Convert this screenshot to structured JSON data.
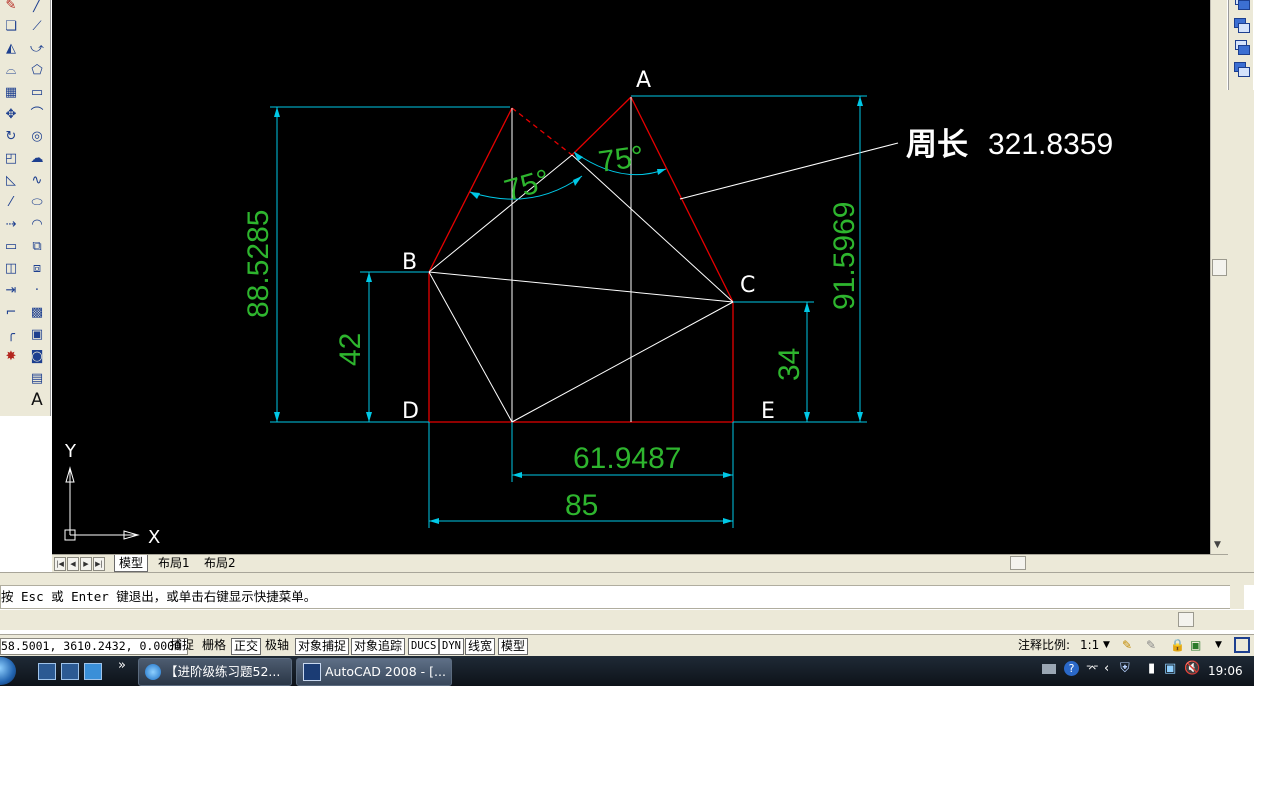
{
  "canvas": {
    "points": {
      "A": "A",
      "B": "B",
      "C": "C",
      "D": "D",
      "E": "E"
    },
    "dimensions": {
      "left_height": "88.5285",
      "right_height": "91.5969",
      "b_height": "42",
      "c_height": "34",
      "inner_width": "61.9487",
      "total_width": "85",
      "angle_left": "75°",
      "angle_right": "75°"
    },
    "annotation": {
      "label": "周长",
      "value": "321.8359"
    },
    "ucs": {
      "x": "X",
      "y": "Y"
    },
    "colors": {
      "background": "#000000",
      "dimension": "#00c8e6",
      "text": "#2eb52e",
      "red_line": "#e60000",
      "white_line": "#ffffff"
    }
  },
  "tabs": [
    "模型",
    "布局1",
    "布局2"
  ],
  "command": {
    "text": "按 Esc 或 Enter 键退出，或单击右键显示快捷菜单。"
  },
  "status": {
    "coords": "58.5001, 3610.2432, 0.0000",
    "buttons": [
      "捕捉",
      "栅格",
      "正交",
      "极轴",
      "对象捕捉",
      "对象追踪",
      "DUCS",
      "DYN",
      "线宽",
      "模型"
    ],
    "annotation_scale_label": "注释比例:",
    "annotation_scale_value": "1:1"
  },
  "taskbar": {
    "items": [
      "【进阶级练习题52...",
      "AutoCAD 2008 - [..."
    ],
    "clock": "19:06",
    "overflow": "»"
  },
  "toolbar_left": {
    "draw_icons": [
      "line-icon",
      "xline-icon",
      "pline-icon",
      "polygon-icon",
      "rectangle-icon",
      "arc-icon",
      "circle-icon",
      "revcloud-icon",
      "spline-icon",
      "ellipse-icon",
      "ellipse-arc-icon",
      "insert-block-icon",
      "make-block-icon",
      "point-icon",
      "hatch-icon",
      "gradient-icon",
      "region-icon",
      "table-icon",
      "mtext-icon"
    ],
    "modify_icons": [
      "erase-icon",
      "copy-icon",
      "mirror-icon",
      "offset-icon",
      "array-icon",
      "move-icon",
      "rotate-icon",
      "scale-icon",
      "stretch-icon",
      "trim-icon",
      "extend-icon",
      "break-icon",
      "join-icon",
      "chamfer-icon",
      "fillet-icon",
      "explode-icon"
    ],
    "text_tool": "A"
  }
}
